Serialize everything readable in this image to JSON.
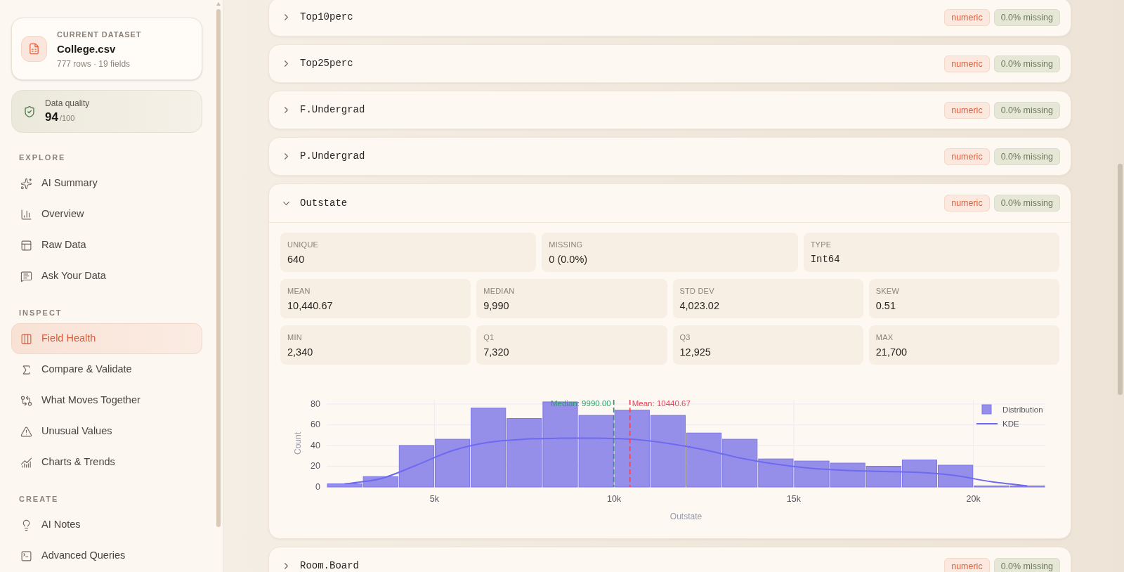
{
  "sidebar": {
    "dataset": {
      "label": "CURRENT DATASET",
      "name": "College.csv",
      "meta": "777 rows · 19 fields"
    },
    "quality": {
      "label": "Data quality",
      "score": "94",
      "max": "/100"
    },
    "sections": [
      {
        "title": "EXPLORE",
        "items": [
          {
            "label": "AI Summary",
            "selected": false
          },
          {
            "label": "Overview",
            "selected": false
          },
          {
            "label": "Raw Data",
            "selected": false
          },
          {
            "label": "Ask Your Data",
            "selected": false
          }
        ]
      },
      {
        "title": "INSPECT",
        "items": [
          {
            "label": "Field Health",
            "selected": true
          },
          {
            "label": "Compare & Validate",
            "selected": false
          },
          {
            "label": "What Moves Together",
            "selected": false
          },
          {
            "label": "Unusual Values",
            "selected": false
          },
          {
            "label": "Charts & Trends",
            "selected": false
          }
        ]
      },
      {
        "title": "CREATE",
        "items": [
          {
            "label": "AI Notes",
            "selected": false
          },
          {
            "label": "Advanced Queries",
            "selected": false
          }
        ]
      }
    ]
  },
  "fields": [
    {
      "name": "Top10perc",
      "expanded": false,
      "badges": [
        {
          "kind": "type",
          "text": "numeric"
        },
        {
          "kind": "missing",
          "text": "0.0% missing"
        }
      ]
    },
    {
      "name": "Top25perc",
      "expanded": false,
      "badges": [
        {
          "kind": "type",
          "text": "numeric"
        },
        {
          "kind": "missing",
          "text": "0.0% missing"
        }
      ]
    },
    {
      "name": "F.Undergrad",
      "expanded": false,
      "badges": [
        {
          "kind": "type",
          "text": "numeric"
        },
        {
          "kind": "missing",
          "text": "0.0% missing"
        }
      ]
    },
    {
      "name": "P.Undergrad",
      "expanded": false,
      "badges": [
        {
          "kind": "type",
          "text": "numeric"
        },
        {
          "kind": "missing",
          "text": "0.0% missing"
        }
      ]
    },
    {
      "name": "Outstate",
      "expanded": true,
      "badges": [
        {
          "kind": "type",
          "text": "numeric"
        },
        {
          "kind": "missing",
          "text": "0.0% missing"
        }
      ],
      "stat_rows": [
        [
          {
            "label": "UNIQUE",
            "value": "640",
            "kind": "number"
          },
          {
            "label": "MISSING",
            "value": "0 (0.0%)",
            "kind": "number"
          },
          {
            "label": "TYPE",
            "value": "Int64",
            "kind": "dtype"
          }
        ],
        [
          {
            "label": "MEAN",
            "value": "10,440.67",
            "kind": "number"
          },
          {
            "label": "MEDIAN",
            "value": "9,990",
            "kind": "number"
          },
          {
            "label": "STD DEV",
            "value": "4,023.02",
            "kind": "number"
          },
          {
            "label": "SKEW",
            "value": "0.51",
            "kind": "number"
          }
        ],
        [
          {
            "label": "MIN",
            "value": "2,340",
            "kind": "number"
          },
          {
            "label": "Q1",
            "value": "7,320",
            "kind": "number"
          },
          {
            "label": "Q3",
            "value": "12,925",
            "kind": "number"
          },
          {
            "label": "MAX",
            "value": "21,700",
            "kind": "number"
          }
        ]
      ],
      "chart_data": {
        "type": "bar",
        "xlabel": "Outstate",
        "ylabel": "Count",
        "x": [
          2500,
          3500,
          4500,
          5500,
          6500,
          7500,
          8500,
          9500,
          10500,
          11500,
          12500,
          13500,
          14500,
          15500,
          16500,
          17500,
          18500,
          19500,
          20500,
          21500
        ],
        "series": [
          {
            "name": "Distribution",
            "color": "#958fea",
            "values": [
              3,
              10,
              40,
              46,
              76,
              66,
              82,
              69,
              74,
              69,
              52,
              46,
              27,
              25,
              23,
              20,
              26,
              21,
              1,
              1
            ]
          },
          {
            "name": "KDE",
            "type": "line",
            "color": "#6e6af0",
            "values": [
              3,
              8,
              21,
              35,
              43,
              46,
              47,
              47,
              46,
              42,
              36,
              28,
              22,
              18,
              16,
              15,
              14,
              11,
              5,
              1
            ]
          }
        ],
        "xlim": [
          2000,
          22000
        ],
        "ylim": [
          0,
          84
        ],
        "xticks": [
          {
            "value": 5000,
            "label": "5k"
          },
          {
            "value": 10000,
            "label": "10k"
          },
          {
            "value": 15000,
            "label": "15k"
          },
          {
            "value": 20000,
            "label": "20k"
          }
        ],
        "yticks": [
          0,
          20,
          40,
          60,
          80
        ],
        "grid": true,
        "legend": "upper right",
        "ref_lines": [
          {
            "axis": "x",
            "value": 9990,
            "label": "Median: 9990.00",
            "color": "#2e9a6a"
          },
          {
            "axis": "x",
            "value": 10440.67,
            "label": "Mean: 10440.67",
            "color": "#e8445a"
          }
        ]
      }
    },
    {
      "name": "Room.Board",
      "expanded": false,
      "badges": [
        {
          "kind": "type",
          "text": "numeric"
        },
        {
          "kind": "missing",
          "text": "0.0% missing"
        }
      ]
    }
  ]
}
